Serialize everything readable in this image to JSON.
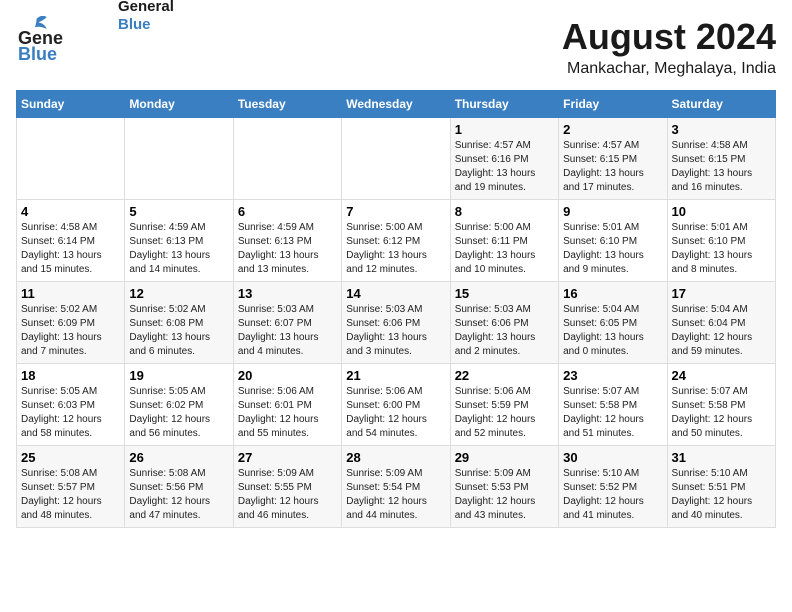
{
  "logo": {
    "line1": "General",
    "line2": "Blue"
  },
  "title": "August 2024",
  "subtitle": "Mankachar, Meghalaya, India",
  "days_of_week": [
    "Sunday",
    "Monday",
    "Tuesday",
    "Wednesday",
    "Thursday",
    "Friday",
    "Saturday"
  ],
  "weeks": [
    [
      {
        "day": "",
        "content": ""
      },
      {
        "day": "",
        "content": ""
      },
      {
        "day": "",
        "content": ""
      },
      {
        "day": "",
        "content": ""
      },
      {
        "day": "1",
        "content": "Sunrise: 4:57 AM\nSunset: 6:16 PM\nDaylight: 13 hours\nand 19 minutes."
      },
      {
        "day": "2",
        "content": "Sunrise: 4:57 AM\nSunset: 6:15 PM\nDaylight: 13 hours\nand 17 minutes."
      },
      {
        "day": "3",
        "content": "Sunrise: 4:58 AM\nSunset: 6:15 PM\nDaylight: 13 hours\nand 16 minutes."
      }
    ],
    [
      {
        "day": "4",
        "content": "Sunrise: 4:58 AM\nSunset: 6:14 PM\nDaylight: 13 hours\nand 15 minutes."
      },
      {
        "day": "5",
        "content": "Sunrise: 4:59 AM\nSunset: 6:13 PM\nDaylight: 13 hours\nand 14 minutes."
      },
      {
        "day": "6",
        "content": "Sunrise: 4:59 AM\nSunset: 6:13 PM\nDaylight: 13 hours\nand 13 minutes."
      },
      {
        "day": "7",
        "content": "Sunrise: 5:00 AM\nSunset: 6:12 PM\nDaylight: 13 hours\nand 12 minutes."
      },
      {
        "day": "8",
        "content": "Sunrise: 5:00 AM\nSunset: 6:11 PM\nDaylight: 13 hours\nand 10 minutes."
      },
      {
        "day": "9",
        "content": "Sunrise: 5:01 AM\nSunset: 6:10 PM\nDaylight: 13 hours\nand 9 minutes."
      },
      {
        "day": "10",
        "content": "Sunrise: 5:01 AM\nSunset: 6:10 PM\nDaylight: 13 hours\nand 8 minutes."
      }
    ],
    [
      {
        "day": "11",
        "content": "Sunrise: 5:02 AM\nSunset: 6:09 PM\nDaylight: 13 hours\nand 7 minutes."
      },
      {
        "day": "12",
        "content": "Sunrise: 5:02 AM\nSunset: 6:08 PM\nDaylight: 13 hours\nand 6 minutes."
      },
      {
        "day": "13",
        "content": "Sunrise: 5:03 AM\nSunset: 6:07 PM\nDaylight: 13 hours\nand 4 minutes."
      },
      {
        "day": "14",
        "content": "Sunrise: 5:03 AM\nSunset: 6:06 PM\nDaylight: 13 hours\nand 3 minutes."
      },
      {
        "day": "15",
        "content": "Sunrise: 5:03 AM\nSunset: 6:06 PM\nDaylight: 13 hours\nand 2 minutes."
      },
      {
        "day": "16",
        "content": "Sunrise: 5:04 AM\nSunset: 6:05 PM\nDaylight: 13 hours\nand 0 minutes."
      },
      {
        "day": "17",
        "content": "Sunrise: 5:04 AM\nSunset: 6:04 PM\nDaylight: 12 hours\nand 59 minutes."
      }
    ],
    [
      {
        "day": "18",
        "content": "Sunrise: 5:05 AM\nSunset: 6:03 PM\nDaylight: 12 hours\nand 58 minutes."
      },
      {
        "day": "19",
        "content": "Sunrise: 5:05 AM\nSunset: 6:02 PM\nDaylight: 12 hours\nand 56 minutes."
      },
      {
        "day": "20",
        "content": "Sunrise: 5:06 AM\nSunset: 6:01 PM\nDaylight: 12 hours\nand 55 minutes."
      },
      {
        "day": "21",
        "content": "Sunrise: 5:06 AM\nSunset: 6:00 PM\nDaylight: 12 hours\nand 54 minutes."
      },
      {
        "day": "22",
        "content": "Sunrise: 5:06 AM\nSunset: 5:59 PM\nDaylight: 12 hours\nand 52 minutes."
      },
      {
        "day": "23",
        "content": "Sunrise: 5:07 AM\nSunset: 5:58 PM\nDaylight: 12 hours\nand 51 minutes."
      },
      {
        "day": "24",
        "content": "Sunrise: 5:07 AM\nSunset: 5:58 PM\nDaylight: 12 hours\nand 50 minutes."
      }
    ],
    [
      {
        "day": "25",
        "content": "Sunrise: 5:08 AM\nSunset: 5:57 PM\nDaylight: 12 hours\nand 48 minutes."
      },
      {
        "day": "26",
        "content": "Sunrise: 5:08 AM\nSunset: 5:56 PM\nDaylight: 12 hours\nand 47 minutes."
      },
      {
        "day": "27",
        "content": "Sunrise: 5:09 AM\nSunset: 5:55 PM\nDaylight: 12 hours\nand 46 minutes."
      },
      {
        "day": "28",
        "content": "Sunrise: 5:09 AM\nSunset: 5:54 PM\nDaylight: 12 hours\nand 44 minutes."
      },
      {
        "day": "29",
        "content": "Sunrise: 5:09 AM\nSunset: 5:53 PM\nDaylight: 12 hours\nand 43 minutes."
      },
      {
        "day": "30",
        "content": "Sunrise: 5:10 AM\nSunset: 5:52 PM\nDaylight: 12 hours\nand 41 minutes."
      },
      {
        "day": "31",
        "content": "Sunrise: 5:10 AM\nSunset: 5:51 PM\nDaylight: 12 hours\nand 40 minutes."
      }
    ]
  ]
}
